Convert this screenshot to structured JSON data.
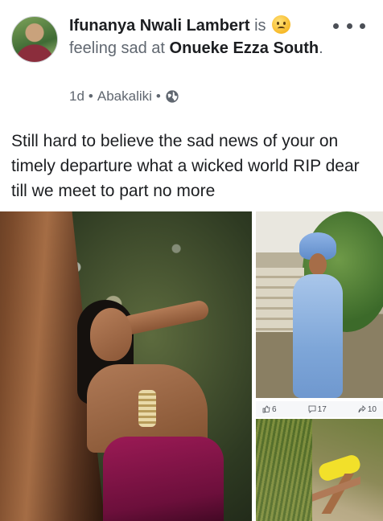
{
  "post": {
    "author": "Ifunanya Nwali Lambert",
    "is_text": "is",
    "feeling_text": "feeling sad at",
    "place": "Onueke Ezza South",
    "place_suffix": ".",
    "time": "1d",
    "separator": "•",
    "location": "Abakaliki",
    "separator2": "•",
    "body": "Still hard to believe the sad news of your on timely departure  what a wicked world RIP dear till we meet to part no more"
  },
  "reactions": {
    "likes": "6",
    "comments": "17",
    "shares": "10"
  },
  "icons": {
    "feeling": "sad-face-emoji",
    "privacy": "globe-icon",
    "more": "more-options-icon"
  },
  "colors": {
    "text_primary": "#1c1e21",
    "text_muted": "#606770",
    "emoji_yellow": "#f7b928"
  }
}
